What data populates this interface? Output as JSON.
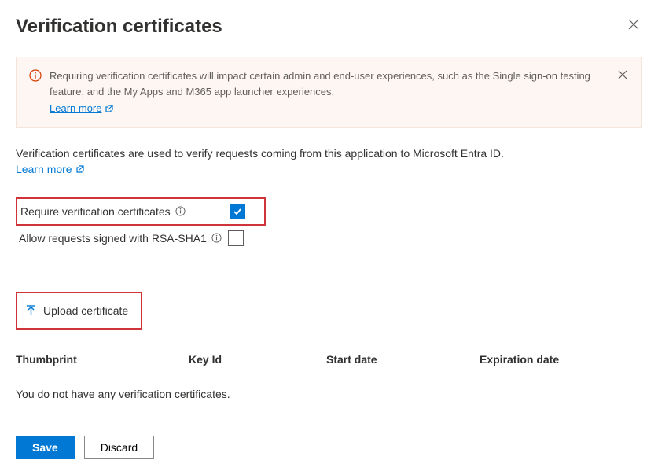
{
  "header": {
    "title": "Verification certificates"
  },
  "banner": {
    "text": "Requiring verification certificates will impact certain admin and end-user experiences, such as the Single sign-on testing feature, and the My Apps and M365 app launcher experiences.",
    "learn_more": "Learn more"
  },
  "description": {
    "text": "Verification certificates are used to verify requests coming from this application to Microsoft Entra ID.",
    "learn_more": "Learn more"
  },
  "settings": {
    "require_label": "Require verification certificates",
    "require_checked": true,
    "allow_rsa_label": "Allow requests signed with RSA-SHA1",
    "allow_rsa_checked": false
  },
  "upload": {
    "label": "Upload certificate"
  },
  "table": {
    "columns": {
      "thumbprint": "Thumbprint",
      "keyid": "Key Id",
      "start": "Start date",
      "expiration": "Expiration date"
    },
    "empty": "You do not have any verification certificates."
  },
  "footer": {
    "save": "Save",
    "discard": "Discard"
  }
}
